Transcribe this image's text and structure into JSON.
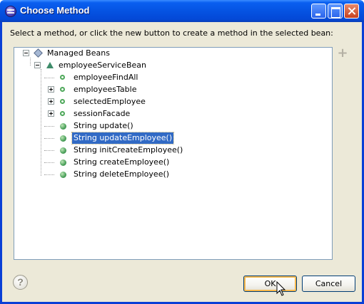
{
  "window": {
    "title": "Choose Method",
    "controls": [
      "minimize-icon",
      "maximize-icon",
      "close-icon"
    ]
  },
  "instructions": "Select a method, or click the new button to create a method in the selected bean:",
  "toolbar": {
    "add_icon": "plus-icon"
  },
  "tree": {
    "root": {
      "label": "Managed Beans",
      "icon": "bean-icon",
      "expanded": true
    },
    "bean": {
      "label": "employeeServiceBean",
      "icon": "triangle-icon",
      "expanded": true
    },
    "children": [
      {
        "label": "employeeFindAll",
        "icon": "property-icon",
        "expandable": false
      },
      {
        "label": "employeesTable",
        "icon": "property-icon",
        "expandable": true
      },
      {
        "label": "selectedEmployee",
        "icon": "property-icon",
        "expandable": true
      },
      {
        "label": "sessionFacade",
        "icon": "property-icon",
        "expandable": true
      },
      {
        "label": "String update()",
        "icon": "method-icon",
        "expandable": false
      },
      {
        "label": "String updateEmployee()",
        "icon": "method-icon",
        "expandable": false,
        "selected": true
      },
      {
        "label": "String initCreateEmployee()",
        "icon": "method-icon",
        "expandable": false
      },
      {
        "label": "String createEmployee()",
        "icon": "method-icon",
        "expandable": false
      },
      {
        "label": "String deleteEmployee()",
        "icon": "method-icon",
        "expandable": false
      }
    ]
  },
  "buttons": {
    "help_label": "?",
    "ok_label": "OK",
    "cancel_label": "Cancel"
  },
  "colors": {
    "title_bar": "#0553e2",
    "selection": "#316ac5",
    "dialog_bg": "#ece9d8"
  }
}
